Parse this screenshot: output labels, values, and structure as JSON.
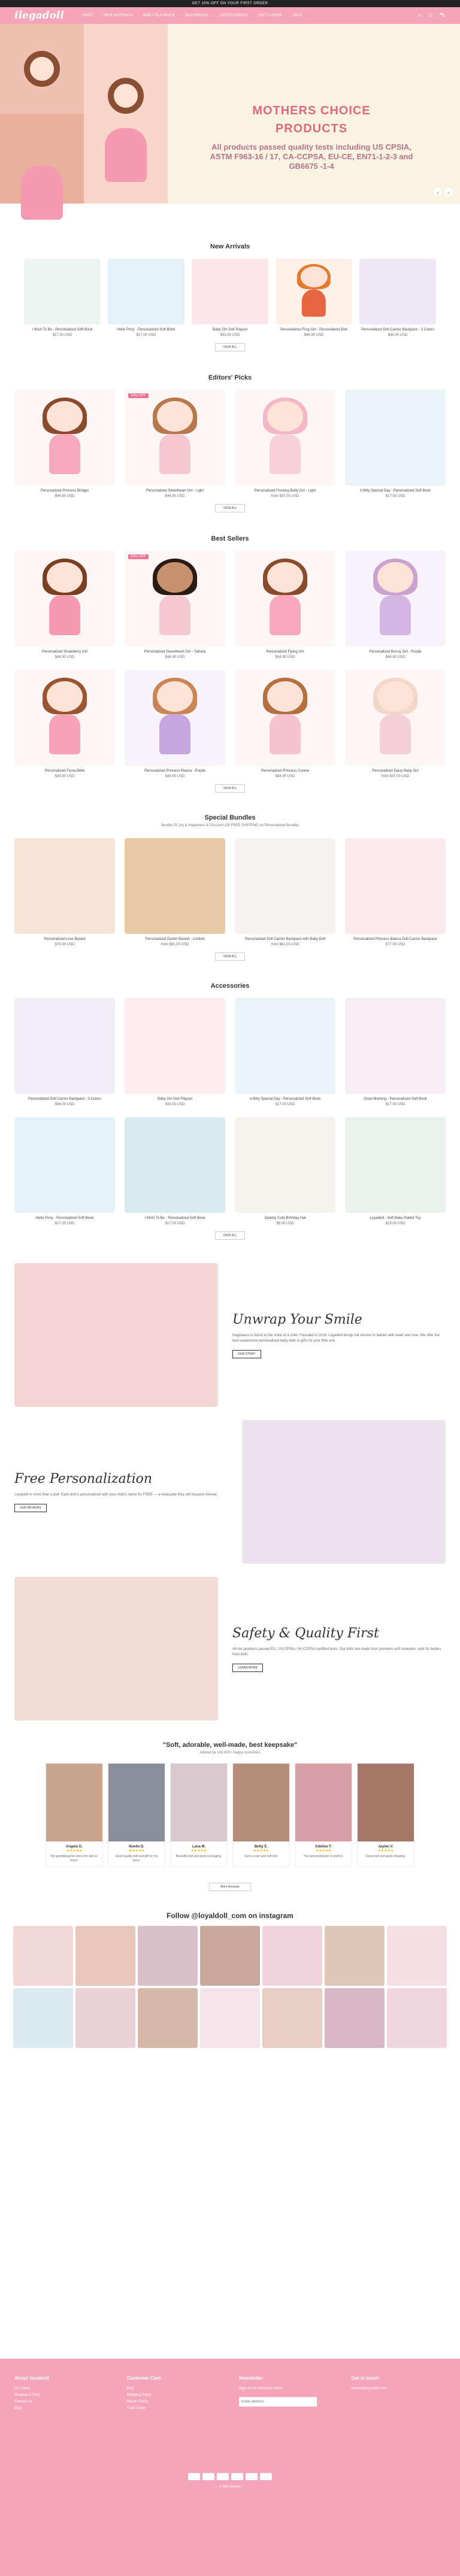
{
  "announcement": "GET 10% OFF ON YOUR FIRST ORDER",
  "header": {
    "logo": "ilegadoll",
    "nav": [
      "Shop",
      "New Arrivals",
      "Baby Playmats",
      "Backpacks",
      "Accessories",
      "Gift Cards",
      "Sale"
    ]
  },
  "hero": {
    "title_line1": "MOTHERS CHOICE",
    "title_line2": "PRODUCTS",
    "subtitle": "All products passed quality tests including US CPSIA, ASTM F963-16 / 17, CA-CCPSA, EU-CE, EN71-1-2-3 and GB6675 -1-4"
  },
  "new_arrivals": {
    "title": "New Arrivals",
    "items": [
      {
        "name": "I Wish To Be - Personalized Soft Book",
        "price": "$17.00 USD"
      },
      {
        "name": "Hello Pony - Personalized Soft Book",
        "price": "$17.00 USD"
      },
      {
        "name": "Baby Girl Doll Playset",
        "price": "$33.00 USD"
      },
      {
        "name": "Personalized Frog Girl - Personalized Doll",
        "price": "$44.90 USD"
      },
      {
        "name": "Personalized Doll Carrier Backpack - 3 Colors",
        "price": "$44.00 USD"
      }
    ],
    "view_all": "VIEW ALL"
  },
  "editors_picks": {
    "title": "Editors' Picks",
    "items": [
      {
        "name": "Personalized Princess Bridget",
        "price": "$44.90 USD",
        "badge": "20% OFF"
      },
      {
        "name": "Personalized Sweetheart Girl - Light",
        "price": "$44.90 USD",
        "badge": "20% OFF"
      },
      {
        "name": "Personalized Frosting Baby Girl - Light",
        "price": "from $37.00 USD"
      },
      {
        "name": "A Bitty Special Day - Personalized Soft Book",
        "price": "$17.00 USD"
      }
    ],
    "view_all": "VIEW ALL"
  },
  "best_sellers": {
    "title": "Best Sellers",
    "items": [
      {
        "name": "Personalized Strawberry Girl",
        "price": "$44.90 USD"
      },
      {
        "name": "Personalized Sweetheart Girl - Sahara",
        "price": "$44.90 USD",
        "badge": "20% OFF"
      },
      {
        "name": "Personalized Flying Girl",
        "price": "$44.90 USD"
      },
      {
        "name": "Personalized Bunny Girl - Purple",
        "price": "$44.90 USD"
      },
      {
        "name": "Personalized Fiona Belle",
        "price": "$44.90 USD"
      },
      {
        "name": "Personalized Princess Bianca - Purple",
        "price": "$44.90 USD"
      },
      {
        "name": "Personalized Princess Connie",
        "price": "$44.90 USD"
      },
      {
        "name": "Personalized Daisy Baby Girl",
        "price": "from $37.00 USD"
      }
    ],
    "view_all": "VIEW ALL"
  },
  "special_bundles": {
    "title": "Special Bundles",
    "subtitle": "Bundle Of Joy & Happiness & Discount (All FREE SHIPPING on Personalized Bundle)",
    "items": [
      {
        "name": "Personalized Love Basket",
        "price": "$73.00 USD"
      },
      {
        "name": "Personalized Easter Basket - Limited",
        "price": "from $81.00 USD"
      },
      {
        "name": "Personalized Doll Carrier Backpack with Baby Doll",
        "price": "from $61.00 USD"
      },
      {
        "name": "Personalized Princess Bianca Doll Carrier Backpack",
        "price": "$77.00 USD"
      }
    ],
    "view_all": "VIEW ALL"
  },
  "accessories": {
    "title": "Accessories",
    "items": [
      {
        "name": "Personalized Doll Carrier Backpack - 3 Colors",
        "price": "$44.00 USD"
      },
      {
        "name": "Baby Girl Doll Playset",
        "price": "$33.00 USD"
      },
      {
        "name": "A Bitty Special Day - Personalized Soft Book",
        "price": "$17.00 USD"
      },
      {
        "name": "Good Morning - Personalized Soft Book",
        "price": "$17.00 USD"
      },
      {
        "name": "Hello Pony - Personalized Soft Book",
        "price": "$17.00 USD"
      },
      {
        "name": "I Wish To Be - Personalized Soft Book",
        "price": "$17.00 USD"
      },
      {
        "name": "Sparkly Cute Birthday Hat",
        "price": "$9.00 USD"
      },
      {
        "name": "Loyaldoll - Soft Baby Rabbit Toy",
        "price": "$23.00 USD"
      }
    ],
    "view_all": "VIEW ALL"
  },
  "unwrap": {
    "title": "Unwrap Your Smile",
    "body": "Happiness is found in the smile of a child. Founded in 2018, Loyaldoll brings full service to babies with heart and love. We offer the best experience personalized baby dolls & gifts for your little one.",
    "button": "OUR STORY"
  },
  "personalization": {
    "title": "Free Personalization",
    "body": "Loyaldoll is more than a doll. Each doll is personalized with your child's name for FREE — a keepsake they will treasure forever.",
    "button": "OUR REVIEWS"
  },
  "safety": {
    "title": "Safety & Quality First",
    "body": "All our products passed EU, US-CPSIA, UK-CCPSA certified tests. Our dolls are made from premium soft materials, safe for babies from birth.",
    "button": "LEARN MORE"
  },
  "reviews": {
    "title": "\"Soft, adorable, well-made, best keepsake\"",
    "subtitle": "Adored by 100,000+ happy customers",
    "items": [
      {
        "name": "Angela G.",
        "text": "My granddaughter loves her doll so much."
      },
      {
        "name": "Noelle D.",
        "text": "Good quality doll and gift for my niece."
      },
      {
        "name": "Lana M.",
        "text": "Beautiful doll and great packaging."
      },
      {
        "name": "Betty E.",
        "text": "Such a cute and soft doll."
      },
      {
        "name": "Adeline F.",
        "text": "The personalization is perfect."
      },
      {
        "name": "Jaylen V.",
        "text": "Great doll and quick shipping."
      }
    ],
    "more": "More Reviews"
  },
  "instagram": {
    "title": "Follow @loyaldoll_com on instagram"
  },
  "footer": {
    "cols": [
      {
        "head": "About loyaldoll",
        "links": [
          "Our Story",
          "Reviews & FAQ",
          "Contact Us",
          "Blog"
        ]
      },
      {
        "head": "Customer Care",
        "links": [
          "FAQ",
          "Shipping Policy",
          "Return Policy",
          "Track Order"
        ]
      },
      {
        "head": "Newsletter",
        "links": [
          "Sign up for exclusive offers"
        ]
      },
      {
        "head": "Get in touch",
        "links": [
          "service@loyaldoll.com"
        ]
      }
    ],
    "email_placeholder": "Email address",
    "copyright": "© 2024 loyaldoll"
  },
  "colors": {
    "brand_pink": "#f5a5b8",
    "accent": "#e0687e"
  }
}
